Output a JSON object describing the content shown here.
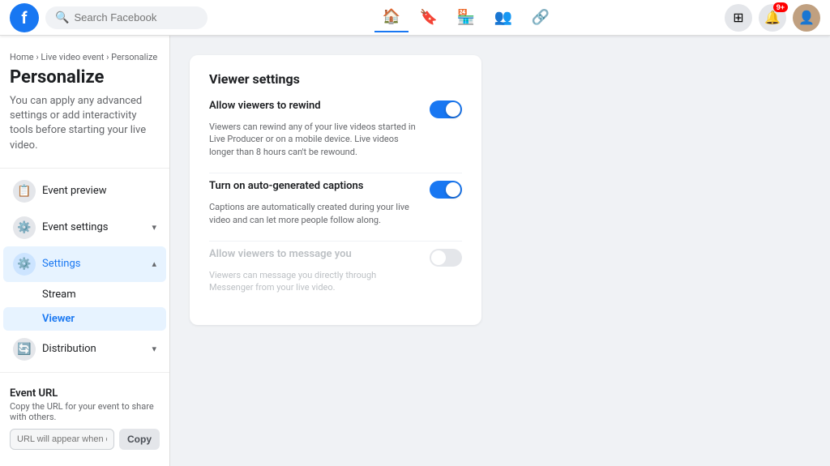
{
  "app": {
    "logo": "f",
    "search_placeholder": "Search Facebook"
  },
  "nav": {
    "icons": [
      "🏠",
      "🔖",
      "🏪",
      "👥",
      "🔗"
    ],
    "active_index": 0,
    "grid_label": "⊞",
    "notification_badge": "9+"
  },
  "breadcrumb": {
    "items": [
      "Home",
      "Live video event",
      "Personalize"
    ],
    "separator": "›"
  },
  "sidebar": {
    "title": "Personalize",
    "description": "You can apply any advanced settings or add interactivity tools before starting your live video.",
    "menu_items": [
      {
        "id": "event-preview",
        "label": "Event preview",
        "icon": "📋",
        "has_chevron": false,
        "active": false
      },
      {
        "id": "event-settings",
        "label": "Event settings",
        "icon": "⚙️",
        "has_chevron": true,
        "active": false
      },
      {
        "id": "settings",
        "label": "Settings",
        "icon": "⚙️",
        "has_chevron": true,
        "active": true,
        "expanded": true
      }
    ],
    "sub_items": [
      {
        "id": "stream",
        "label": "Stream",
        "active": false
      },
      {
        "id": "viewer",
        "label": "Viewer",
        "active": true
      }
    ],
    "distribution_item": {
      "id": "distribution",
      "label": "Distribution",
      "icon": "🔄",
      "has_chevron": true,
      "active": false
    },
    "event_url": {
      "title": "Event URL",
      "description": "Copy the URL for your event to share with others.",
      "placeholder": "URL will appear when event is creat",
      "copy_label": "Copy"
    }
  },
  "viewer_settings": {
    "card_title": "Viewer settings",
    "settings": [
      {
        "id": "allow-rewind",
        "label": "Allow viewers to rewind",
        "description": "Viewers can rewind any of your live videos started in Live Producer or on a mobile device. Live videos longer than 8 hours can't be rewound.",
        "enabled": true,
        "disabled": false
      },
      {
        "id": "auto-captions",
        "label": "Turn on auto-generated captions",
        "description": "Captions are automatically created during your live video and can let more people follow along.",
        "enabled": true,
        "disabled": false
      },
      {
        "id": "allow-message",
        "label": "Allow viewers to message you",
        "description": "Viewers can message you directly through Messenger from your live video.",
        "enabled": false,
        "disabled": true
      }
    ]
  }
}
